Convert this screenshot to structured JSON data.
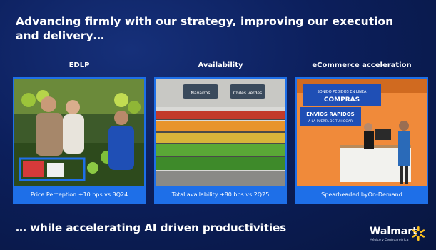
{
  "slide": {
    "title": "Advancing firmly with our strategy, improving our execution and delivery…",
    "bottom_text": "… while accelerating AI driven productivities"
  },
  "columns": [
    {
      "label": "EDLP",
      "caption": "Price Perception:+10 bps vs 3Q24"
    },
    {
      "label": "Availability",
      "caption": "Total availability +80 bps vs 2Q25"
    },
    {
      "label": "eCommerce acceleration",
      "caption": "Spearheaded byOn-Demand"
    }
  ],
  "store_signs": {
    "sign1": "Navarros",
    "sign2": "Chiles verdes",
    "banner1": "SONIDO PEDIDOS EN LINEA",
    "banner2": "COMPRAS",
    "banner3": "ENVÍOS RÁPIDOS",
    "banner4": "A LA PUERTA DE TU HOGAR"
  },
  "logo": {
    "word": "Walmart",
    "sub": "México y Centroamérica"
  },
  "colors": {
    "background": "#0c1f5c",
    "accent": "#1e6fe8",
    "spark": "#ffc220"
  }
}
